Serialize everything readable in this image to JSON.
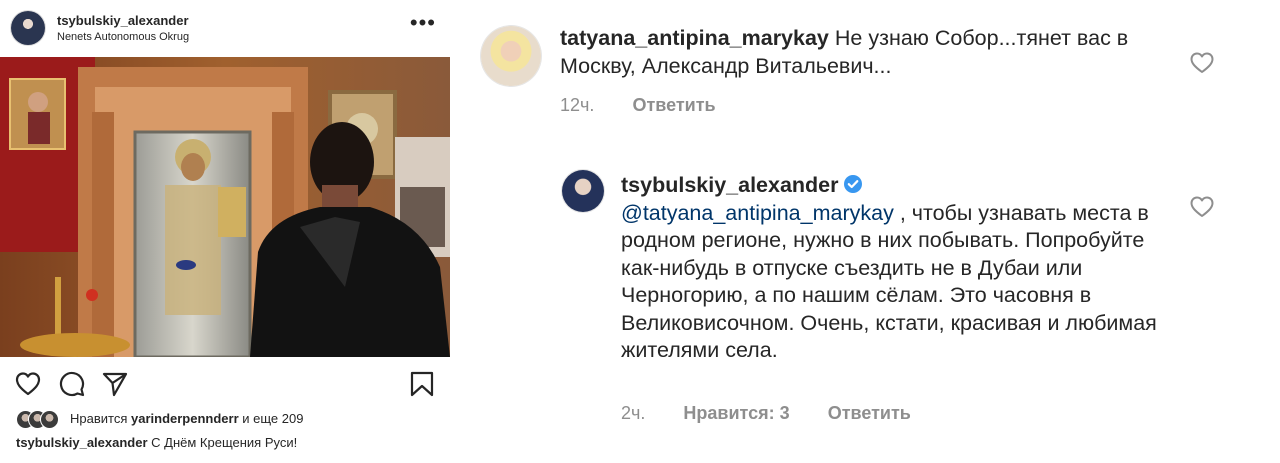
{
  "post": {
    "username": "tsybulskiy_alexander",
    "location": "Nenets Autonomous Okrug",
    "more_icon": "more-dots-icon",
    "likes": {
      "prefix": "Нравится",
      "user": "yarinderpennderr",
      "suffix": "и еще 209"
    },
    "caption": {
      "username": "tsybulskiy_alexander",
      "text": "С Днём Крещения Руси!"
    },
    "actions": [
      "heart-icon",
      "comment-icon",
      "share-icon",
      "bookmark-icon"
    ]
  },
  "comments": [
    {
      "username": "tatyana_antipina_marykay",
      "text": "Не узнаю Собор...тянет вас в Москву, Александр Витальевич...",
      "time": "12ч.",
      "reply_label": "Ответить"
    },
    {
      "username": "tsybulskiy_alexander",
      "verified": true,
      "mention": "@tatyana_antipina_marykay",
      "text": ", чтобы узнавать места в родном регионе, нужно в них побывать. Попробуйте как-нибудь в отпуске съездить не в Дубаи или Черногорию, а по нашим сёлам. Это часовня в Великовисочном. Очень, кстати, красивая и любимая жителями села.",
      "time": "2ч.",
      "likes_label": "Нравится: 3",
      "reply_label": "Ответить"
    }
  ],
  "colors": {
    "text": "#262626",
    "meta": "#8e8e8e",
    "mention": "#003569",
    "verified": "#3897f0"
  }
}
